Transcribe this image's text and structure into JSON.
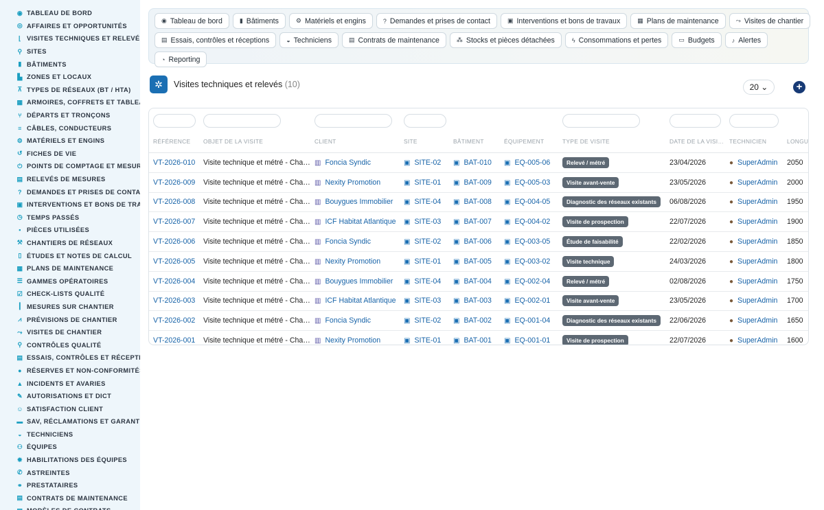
{
  "sidebar": {
    "items": [
      {
        "label": "TABLEAU DE BORD",
        "icon": "dashboard-icon",
        "glyph": "◉"
      },
      {
        "label": "AFFAIRES ET OPPORTUNITÉS",
        "icon": "target-icon",
        "glyph": "◎"
      },
      {
        "label": "VISITES TECHNIQUES ET RELEVÉS",
        "icon": "ruler-icon",
        "glyph": "⌊"
      },
      {
        "label": "SITES",
        "icon": "pin-icon",
        "glyph": "⚲"
      },
      {
        "label": "BÂTIMENTS",
        "icon": "building-icon",
        "glyph": "▮"
      },
      {
        "label": "ZONES ET LOCAUX",
        "icon": "rooms-icon",
        "glyph": "▙"
      },
      {
        "label": "TYPES DE RÉSEAUX (BT / HTA)",
        "icon": "network-icon",
        "glyph": "⊼"
      },
      {
        "label": "ARMOIRES, COFFRETS ET TABLEAUX",
        "icon": "grid-icon",
        "glyph": "▦"
      },
      {
        "label": "DÉPARTS ET TRONÇONS",
        "icon": "branch-icon",
        "glyph": "⑂"
      },
      {
        "label": "CÂBLES, CONDUCTEURS",
        "icon": "cable-icon",
        "glyph": "≡"
      },
      {
        "label": "MATÉRIELS ET ENGINS",
        "icon": "cogs-icon",
        "glyph": "⚙"
      },
      {
        "label": "FICHES DE VIE",
        "icon": "history-icon",
        "glyph": "↺"
      },
      {
        "label": "POINTS DE COMPTAGE ET MESURE",
        "icon": "plug-icon",
        "glyph": "⏻"
      },
      {
        "label": "RELEVÉS DE MESURES",
        "icon": "clipboard-icon",
        "glyph": "▤"
      },
      {
        "label": "DEMANDES ET PRISES DE CONTACT",
        "icon": "question-icon",
        "glyph": "?"
      },
      {
        "label": "INTERVENTIONS ET BONS DE TRAVAUX",
        "icon": "clipboard-check-icon",
        "glyph": "▣"
      },
      {
        "label": "TEMPS PASSÉS",
        "icon": "clock-icon",
        "glyph": "◷"
      },
      {
        "label": "PIÈCES UTILISÉES",
        "icon": "box-icon",
        "glyph": "▪"
      },
      {
        "label": "CHANTIERS DE RÉSEAUX",
        "icon": "hammer-icon",
        "glyph": "⚒"
      },
      {
        "label": "ÉTUDES ET NOTES DE CALCUL",
        "icon": "file-icon",
        "glyph": "▯"
      },
      {
        "label": "PLANS DE MAINTENANCE",
        "icon": "calendar-icon",
        "glyph": "▦"
      },
      {
        "label": "GAMMES OPÉRATOIRES",
        "icon": "list-icon",
        "glyph": "☰"
      },
      {
        "label": "CHECK-LISTS QUALITÉ",
        "icon": "checklist-icon",
        "glyph": "☑"
      },
      {
        "label": "MESURES SUR CHANTIER",
        "icon": "thermometer-icon",
        "glyph": "┃"
      },
      {
        "label": "PRÉVISIONS DE CHANTIER",
        "icon": "chart-icon",
        "glyph": "⩘"
      },
      {
        "label": "VISITES DE CHANTIER",
        "icon": "route-icon",
        "glyph": "⤳"
      },
      {
        "label": "CONTRÔLES QUALITÉ",
        "icon": "search-icon",
        "glyph": "⚲"
      },
      {
        "label": "ESSAIS, CONTRÔLES ET RÉCEPTIONS",
        "icon": "clipboard-icon",
        "glyph": "▤"
      },
      {
        "label": "RÉSERVES ET NON-CONFORMITÉS",
        "icon": "alert-circle-icon",
        "glyph": "●"
      },
      {
        "label": "INCIDENTS ET AVARIES",
        "icon": "warning-icon",
        "glyph": "▲"
      },
      {
        "label": "AUTORISATIONS ET DICT",
        "icon": "file-signature-icon",
        "glyph": "✎"
      },
      {
        "label": "SATISFACTION CLIENT",
        "icon": "smile-icon",
        "glyph": "☺"
      },
      {
        "label": "SAV, RÉCLAMATIONS ET GARANTIES",
        "icon": "comment-icon",
        "glyph": "▬"
      },
      {
        "label": "TECHNICIENS",
        "icon": "hard-hat-icon",
        "glyph": "◒"
      },
      {
        "label": "ÉQUIPES",
        "icon": "users-icon",
        "glyph": "⚇"
      },
      {
        "label": "HABILITATIONS DES ÉQUIPES",
        "icon": "certificate-icon",
        "glyph": "✹"
      },
      {
        "label": "ASTREINTES",
        "icon": "phone-icon",
        "glyph": "✆"
      },
      {
        "label": "PRESTATAIRES",
        "icon": "handshake-icon",
        "glyph": "⚭"
      },
      {
        "label": "CONTRATS DE MAINTENANCE",
        "icon": "contract-icon",
        "glyph": "▤"
      },
      {
        "label": "MODÈLES DE CONTRATS",
        "icon": "template-icon",
        "glyph": "▤"
      }
    ]
  },
  "nav": {
    "rows": [
      [
        {
          "label": "Tableau de bord",
          "icon": "dashboard-icon",
          "glyph": "◉"
        },
        {
          "label": "Bâtiments",
          "icon": "building-icon",
          "glyph": "▮"
        },
        {
          "label": "Matériels et engins",
          "icon": "cogs-icon",
          "glyph": "⚙"
        },
        {
          "label": "Demandes et prises de contact",
          "icon": "question-icon",
          "glyph": "?"
        },
        {
          "label": "Interventions et bons de travaux",
          "icon": "clipboard-check-icon",
          "glyph": "▣"
        },
        {
          "label": "Plans de maintenance",
          "icon": "calendar-icon",
          "glyph": "▦"
        },
        {
          "label": "Visites de chantier",
          "icon": "route-icon",
          "glyph": "⤳"
        }
      ],
      [
        {
          "label": "Essais, contrôles et réceptions",
          "icon": "clipboard-icon",
          "glyph": "▤"
        },
        {
          "label": "Techniciens",
          "icon": "hard-hat-icon",
          "glyph": "◒"
        },
        {
          "label": "Contrats de maintenance",
          "icon": "contract-icon",
          "glyph": "▤"
        },
        {
          "label": "Stocks et pièces détachées",
          "icon": "boxes-icon",
          "glyph": "⁂"
        },
        {
          "label": "Consommations et pertes",
          "icon": "bolt-icon",
          "glyph": "ϟ"
        },
        {
          "label": "Budgets",
          "icon": "money-icon",
          "glyph": "▭"
        },
        {
          "label": "Alertes",
          "icon": "bell-icon",
          "glyph": "♪"
        }
      ],
      [
        {
          "label": "Reporting",
          "icon": "pie-icon",
          "glyph": "◔"
        }
      ]
    ]
  },
  "page": {
    "title": "Visites techniques et relevés",
    "count": "(10)",
    "per_page": "20 ⌄",
    "add_glyph": "+"
  },
  "table": {
    "columns": [
      "RÉFÉRENCE",
      "OBJET DE LA VISITE",
      "CLIENT",
      "SITE",
      "BÂTIMENT",
      "ÉQUIPEMENT",
      "TYPE DE VISITE",
      "DATE DE LA VISITE",
      "TECHNICIEN",
      "LONGUEUR"
    ],
    "rows": [
      {
        "ref": "VT-2026-010",
        "objet": "Visite technique et métré - Chantier",
        "client": "Foncia Syndic",
        "site": "SITE-02",
        "bat": "BAT-010",
        "equip": "EQ-005-06",
        "type": "Relevé / métré",
        "date": "23/04/2026",
        "tech": "SuperAdmin",
        "len": "2050"
      },
      {
        "ref": "VT-2026-009",
        "objet": "Visite technique et métré - Chantier",
        "client": "Nexity Promotion",
        "site": "SITE-01",
        "bat": "BAT-009",
        "equip": "EQ-005-03",
        "type": "Visite avant-vente",
        "date": "23/05/2026",
        "tech": "SuperAdmin",
        "len": "2000"
      },
      {
        "ref": "VT-2026-008",
        "objet": "Visite technique et métré - Chantier",
        "client": "Bouygues Immobilier",
        "site": "SITE-04",
        "bat": "BAT-008",
        "equip": "EQ-004-05",
        "type": "Diagnostic des réseaux existants",
        "date": "06/08/2026",
        "tech": "SuperAdmin",
        "len": "1950"
      },
      {
        "ref": "VT-2026-007",
        "objet": "Visite technique et métré - Chantier",
        "client": "ICF Habitat Atlantique",
        "site": "SITE-03",
        "bat": "BAT-007",
        "equip": "EQ-004-02",
        "type": "Visite de prospection",
        "date": "22/07/2026",
        "tech": "SuperAdmin",
        "len": "1900"
      },
      {
        "ref": "VT-2026-006",
        "objet": "Visite technique et métré - Chantier",
        "client": "Foncia Syndic",
        "site": "SITE-02",
        "bat": "BAT-006",
        "equip": "EQ-003-05",
        "type": "Étude de faisabilité",
        "date": "22/02/2026",
        "tech": "SuperAdmin",
        "len": "1850"
      },
      {
        "ref": "VT-2026-005",
        "objet": "Visite technique et métré - Chantier",
        "client": "Nexity Promotion",
        "site": "SITE-01",
        "bat": "BAT-005",
        "equip": "EQ-003-02",
        "type": "Visite technique",
        "date": "24/03/2026",
        "tech": "SuperAdmin",
        "len": "1800"
      },
      {
        "ref": "VT-2026-004",
        "objet": "Visite technique et métré - Chantier",
        "client": "Bouygues Immobilier",
        "site": "SITE-04",
        "bat": "BAT-004",
        "equip": "EQ-002-04",
        "type": "Relevé / métré",
        "date": "02/08/2026",
        "tech": "SuperAdmin",
        "len": "1750"
      },
      {
        "ref": "VT-2026-003",
        "objet": "Visite technique et métré - Chantier",
        "client": "ICF Habitat Atlantique",
        "site": "SITE-03",
        "bat": "BAT-003",
        "equip": "EQ-002-01",
        "type": "Visite avant-vente",
        "date": "23/05/2026",
        "tech": "SuperAdmin",
        "len": "1700"
      },
      {
        "ref": "VT-2026-002",
        "objet": "Visite technique et métré - Chantier",
        "client": "Foncia Syndic",
        "site": "SITE-02",
        "bat": "BAT-002",
        "equip": "EQ-001-04",
        "type": "Diagnostic des réseaux existants",
        "date": "22/06/2026",
        "tech": "SuperAdmin",
        "len": "1650"
      },
      {
        "ref": "VT-2026-001",
        "objet": "Visite technique et métré - Chantier",
        "client": "Nexity Promotion",
        "site": "SITE-01",
        "bat": "BAT-001",
        "equip": "EQ-001-01",
        "type": "Visite de prospection",
        "date": "22/07/2026",
        "tech": "SuperAdmin",
        "len": "1600"
      }
    ]
  },
  "icons": {
    "client": "▥",
    "site": "▣",
    "building": "▣",
    "equipment": "▣",
    "user": "●",
    "logo": "✲"
  },
  "colors": {
    "link": "#1763a8",
    "badge": "#5d6873",
    "accent": "#173a75",
    "sidebar_bg": "#eef6fb"
  }
}
